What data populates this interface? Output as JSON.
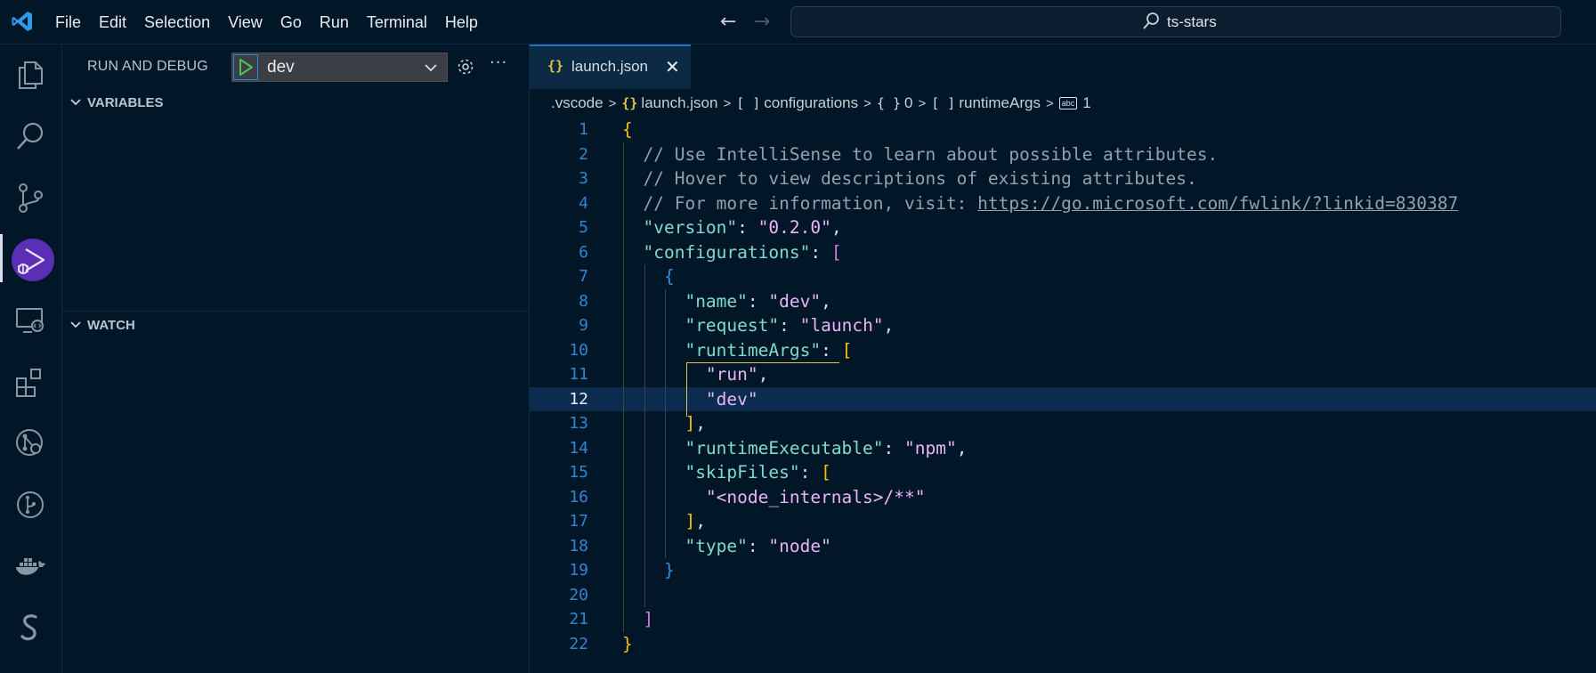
{
  "titlebar": {
    "menu": [
      "File",
      "Edit",
      "Selection",
      "View",
      "Go",
      "Run",
      "Terminal",
      "Help"
    ],
    "search_text": "ts-stars"
  },
  "activitybar": {
    "items": [
      "explorer-icon",
      "search-icon",
      "source-control-icon",
      "run-debug-icon",
      "remote-explorer-icon",
      "extensions-icon",
      "git-graph-icon",
      "gitlens-icon",
      "docker-icon",
      "stylus-icon"
    ],
    "active": "run-debug-icon"
  },
  "sidebar": {
    "title": "RUN AND DEBUG",
    "config_name": "dev",
    "sections": {
      "variables": "VARIABLES",
      "watch": "WATCH"
    }
  },
  "editor": {
    "tab": {
      "icon": "{}",
      "label": "launch.json"
    },
    "breadcrumb": {
      "folder": ".vscode",
      "file_icon": "{}",
      "file": "launch.json",
      "seg1_icon": "[ ]",
      "seg1": "configurations",
      "seg2_icon": "{ }",
      "seg2": "0",
      "seg3_icon": "[ ]",
      "seg3": "runtimeArgs",
      "seg4_icon": "abc",
      "seg4": "1"
    },
    "current_line": 12,
    "lines": [
      "{",
      "  // Use IntelliSense to learn about possible attributes.",
      "  // Hover to view descriptions of existing attributes.",
      "  // For more information, visit: https://go.microsoft.com/fwlink/?linkid=830387",
      "  \"version\": \"0.2.0\",",
      "  \"configurations\": [",
      "    {",
      "      \"name\": \"dev\",",
      "      \"request\": \"launch\",",
      "      \"runtimeArgs\": [",
      "        \"run\",",
      "        \"dev\"",
      "      ],",
      "      \"runtimeExecutable\": \"npm\",",
      "      \"skipFiles\": [",
      "        \"<node_internals>/**\"",
      "      ],",
      "      \"type\": \"node\"",
      "    }",
      "",
      "  ]",
      "}"
    ]
  },
  "colors": {
    "background": "#011627",
    "key": "#7fdbca",
    "string": "#e8b5f7",
    "comment": "#93a1ad",
    "bracket1": "#f4c20d",
    "bracket2": "#d77ae0",
    "bracket3": "#2e8fe0",
    "accent": "#5b2fb5"
  }
}
